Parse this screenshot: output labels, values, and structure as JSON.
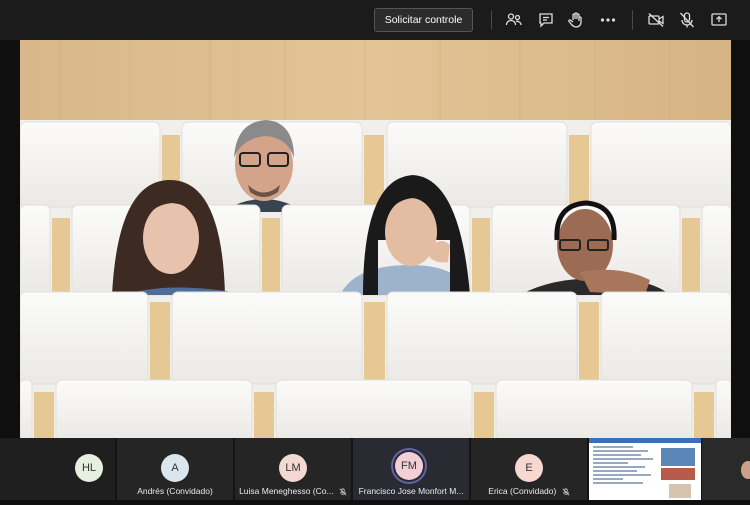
{
  "toolbar": {
    "request_control_label": "Solicitar controle",
    "icons": [
      "participants-icon",
      "chat-icon",
      "raise-hand-icon",
      "more-icon",
      "camera-off-icon",
      "mic-off-icon",
      "share-icon"
    ]
  },
  "participants": [
    {
      "initials": "HL",
      "name": "",
      "avatar_color": "#e6efe0"
    },
    {
      "initials": "A",
      "name": "Andrés (Convidado)",
      "avatar_color": "#d9e6ee"
    },
    {
      "initials": "LM",
      "name": "Luisa Meneghesso (Co...",
      "avatar_color": "#f4d9d2",
      "muted": true
    },
    {
      "initials": "FM",
      "name": "Francisco Jose Monfort M...",
      "avatar_color": "#f2cfd6",
      "active": true
    },
    {
      "initials": "E",
      "name": "Erica (Convidado)",
      "avatar_color": "#f6d8d0",
      "muted": true
    }
  ],
  "colors": {
    "accent": "#6264a7",
    "topbar": "#1b1b1b",
    "strip": "#141414"
  }
}
